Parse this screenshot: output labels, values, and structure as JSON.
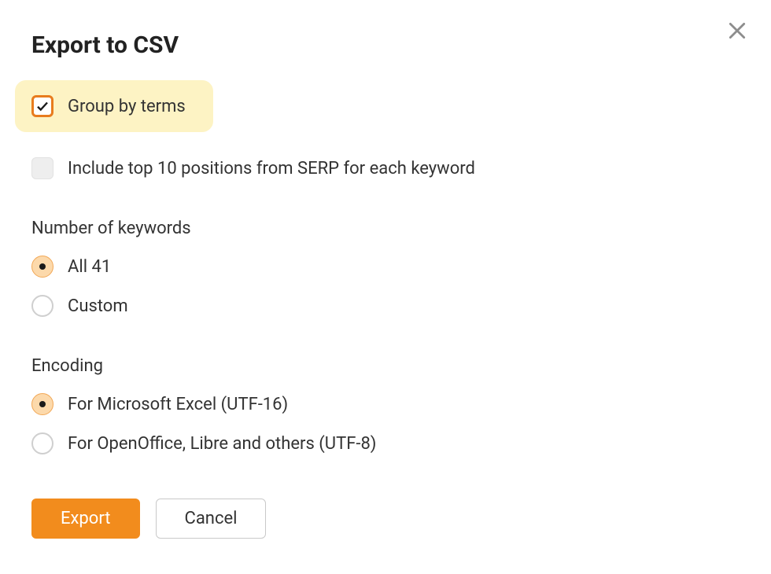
{
  "dialog": {
    "title": "Export to CSV",
    "checkboxes": {
      "group_by_terms": {
        "label": "Group by terms",
        "checked": true,
        "highlighted": true
      },
      "include_top10": {
        "label": "Include top 10 positions from SERP for each keyword",
        "checked": false
      }
    },
    "keywords_section": {
      "label": "Number of keywords",
      "options": {
        "all": {
          "label": "All 41",
          "selected": true
        },
        "custom": {
          "label": "Custom",
          "selected": false
        }
      }
    },
    "encoding_section": {
      "label": "Encoding",
      "options": {
        "utf16": {
          "label": "For Microsoft Excel (UTF-16)",
          "selected": true
        },
        "utf8": {
          "label": "For OpenOffice, Libre and others (UTF-8)",
          "selected": false
        }
      }
    },
    "buttons": {
      "export": "Export",
      "cancel": "Cancel"
    }
  },
  "colors": {
    "accent": "#f28c1d",
    "highlight": "#fdf3c4"
  }
}
